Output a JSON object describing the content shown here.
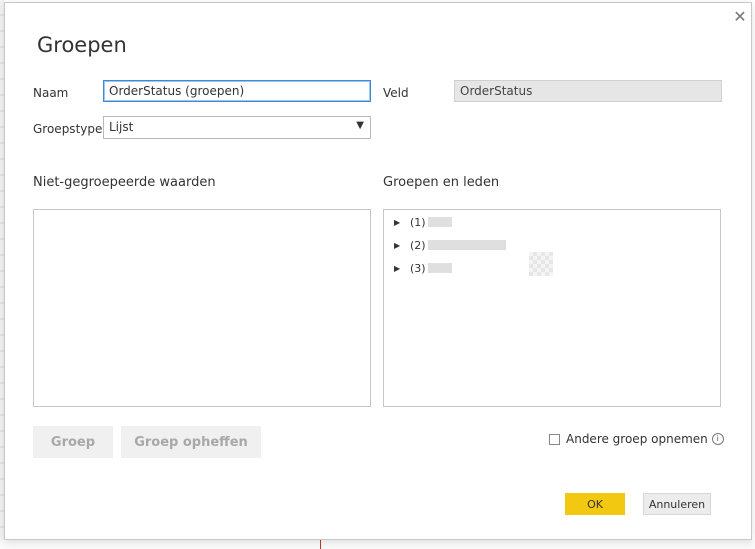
{
  "dialog": {
    "title": "Groepen",
    "close_icon": "close-icon"
  },
  "form": {
    "name_label": "Naam",
    "name_value": "OrderStatus (groepen)",
    "field_label": "Veld",
    "field_value": "OrderStatus",
    "grouptype_label": "Groepstype",
    "grouptype_value": "Lijst"
  },
  "ungrouped": {
    "heading": "Niet-gegroepeerde waarden",
    "items": []
  },
  "groups": {
    "heading": "Groepen en leden",
    "items": [
      {
        "label": "(1)"
      },
      {
        "label": "(2)"
      },
      {
        "label": "(3)"
      }
    ]
  },
  "actions": {
    "group_label": "Groep",
    "ungroup_label": "Groep opheffen",
    "include_other_label": "Andere groep opnemen",
    "info_icon": "info-icon",
    "ok_label": "OK",
    "cancel_label": "Annuleren"
  },
  "colors": {
    "accent": "#f2c811",
    "focus_border": "#3e89d6"
  }
}
